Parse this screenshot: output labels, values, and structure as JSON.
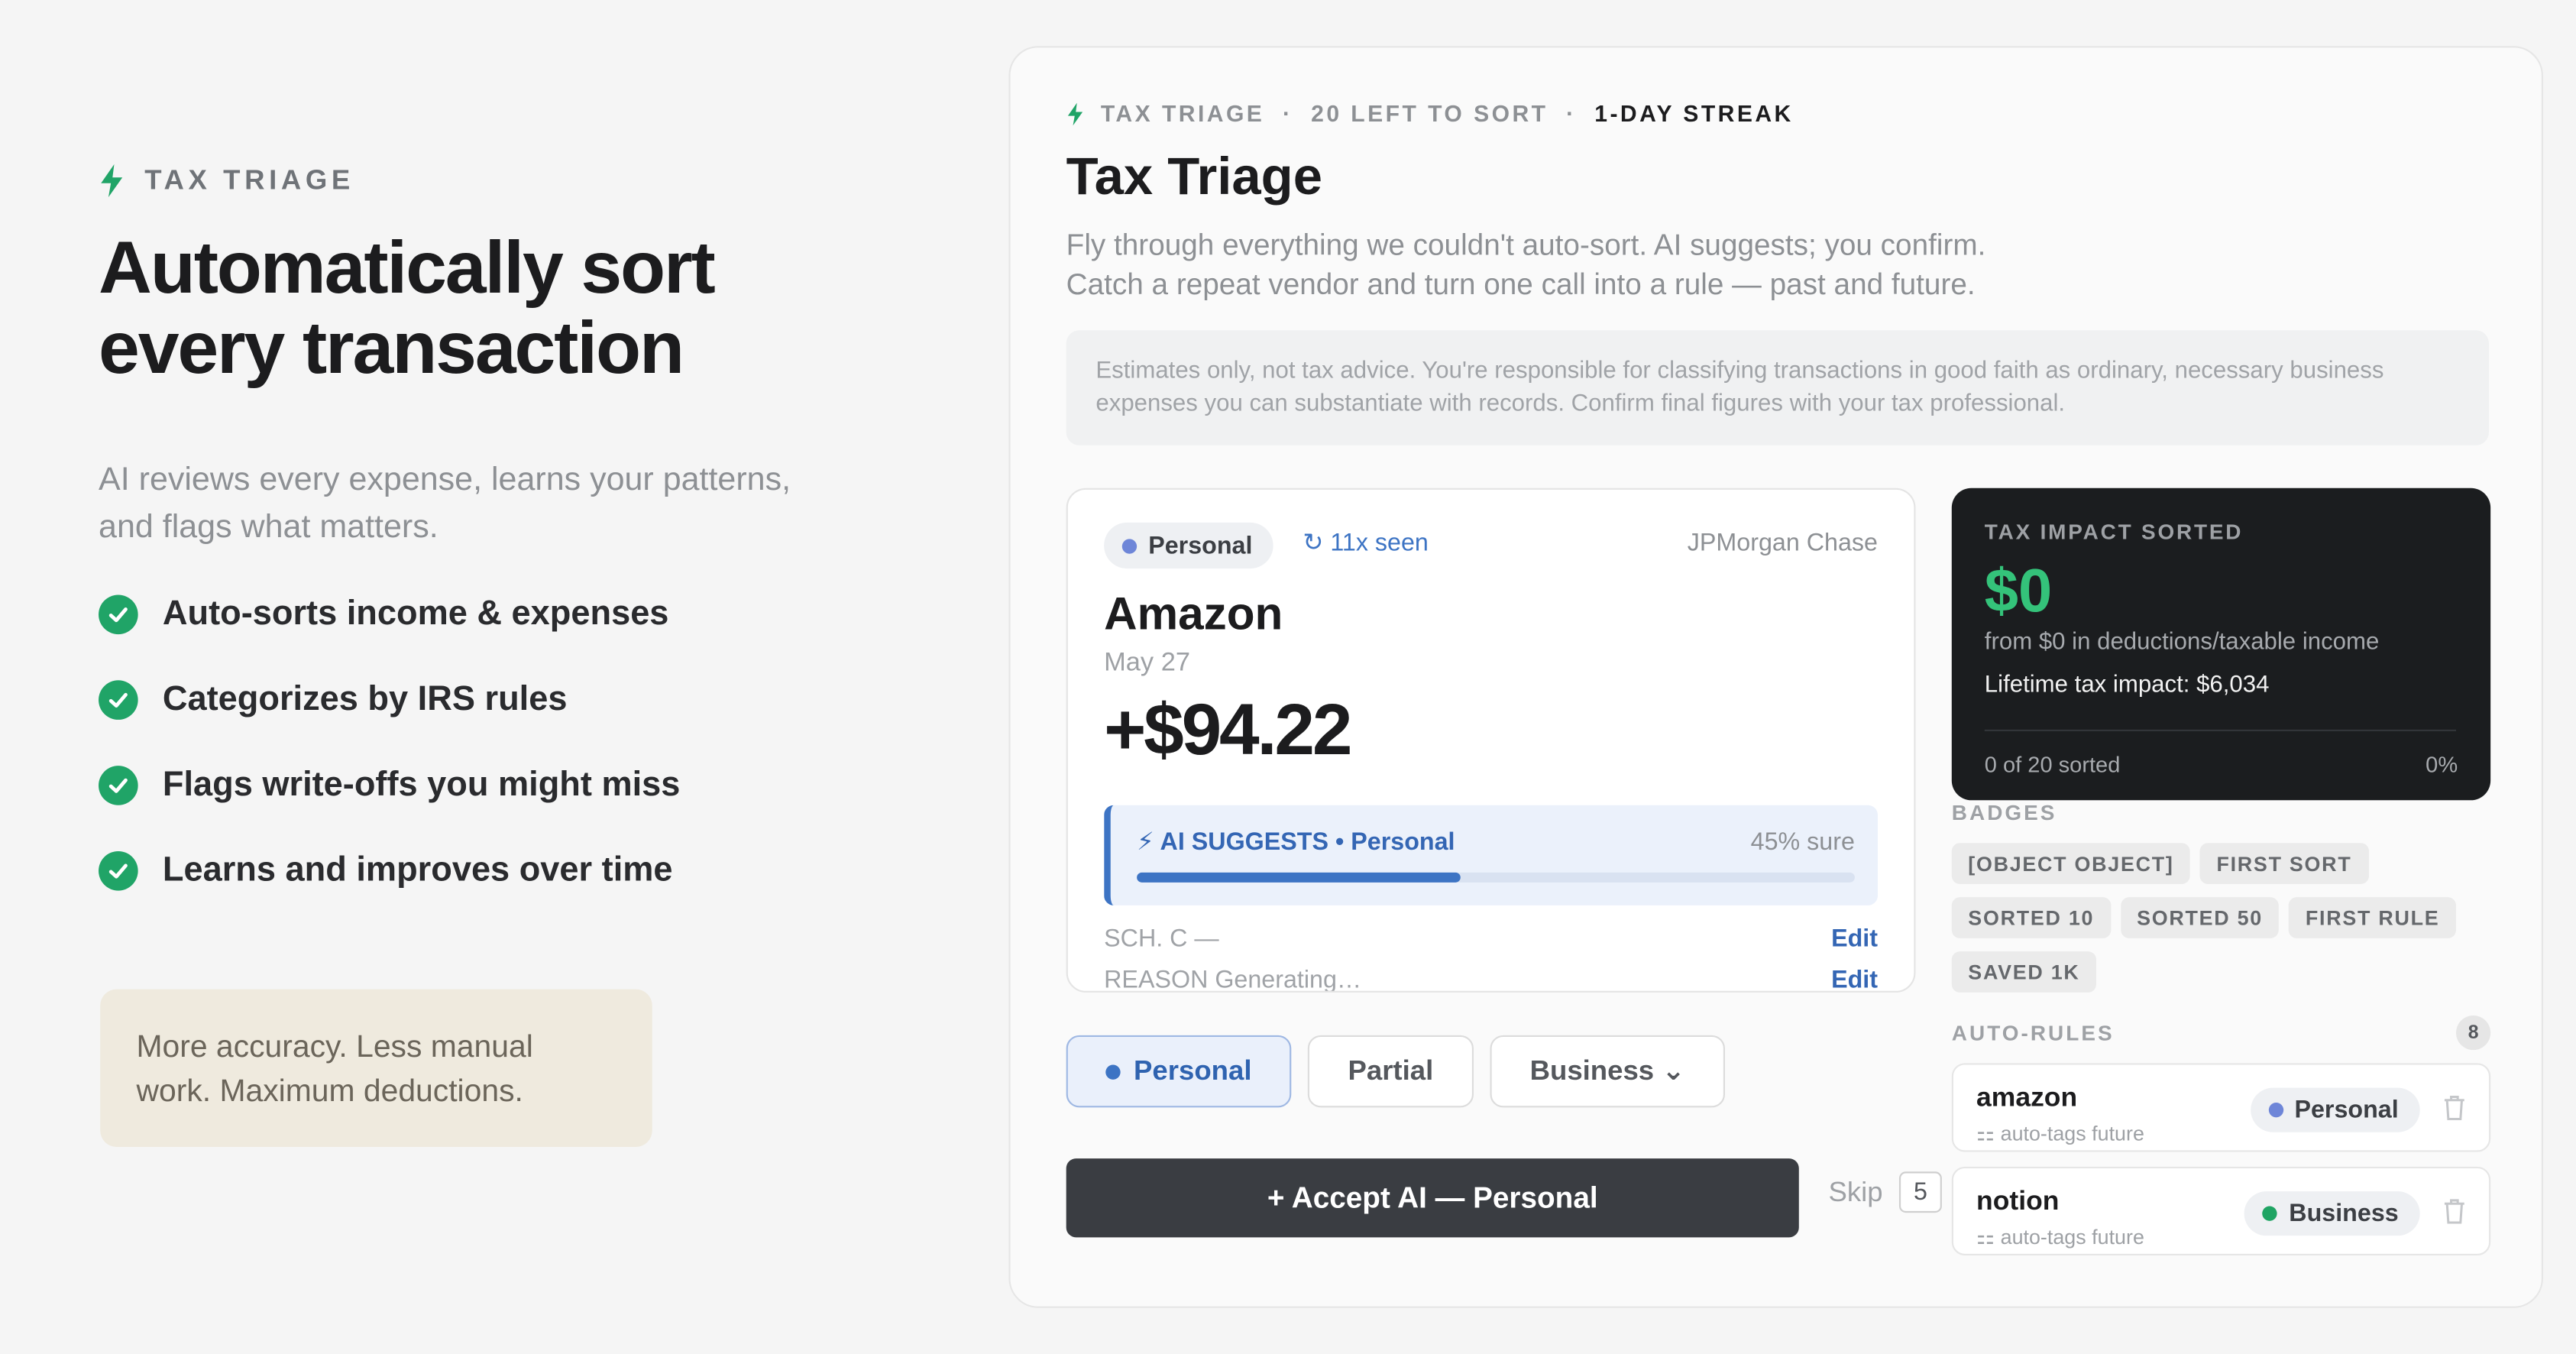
{
  "hero": {
    "eyebrow": "TAX TRIAGE",
    "title_line1": "Automatically sort",
    "title_line2": "every transaction",
    "subtitle": "AI reviews every expense, learns your patterns, and flags what matters.",
    "features": [
      "Auto-sorts income & expenses",
      "Categorizes by IRS rules",
      "Flags write-offs you might miss",
      "Learns and improves over time"
    ],
    "note": "More accuracy. Less manual work. Maximum deductions."
  },
  "panel": {
    "eyebrow": {
      "label": "TAX TRIAGE",
      "left": "20 LEFT TO SORT",
      "streak": "1-DAY STREAK",
      "separator": "·"
    },
    "title": "Tax Triage",
    "subtitle_line1": "Fly through everything we couldn't auto-sort. AI suggests; you confirm.",
    "subtitle_line2": "Catch a repeat vendor and turn one call into a rule — past and future.",
    "disclaimer": "Estimates only, not tax advice. You're responsible for classifying transactions in good faith as ordinary, necessary business expenses you can substantiate with records. Confirm final figures with your tax professional."
  },
  "transaction": {
    "tag": "Personal",
    "seen": "↻ 11x seen",
    "bank": "JPMorgan Chase",
    "merchant": "Amazon",
    "date": "May 27",
    "amount": "+$94.22",
    "ai": {
      "label": "⚡ AI SUGGESTS  •  Personal",
      "confidence_text": "45% sure",
      "confidence": 0.45
    },
    "sch_label": "SCH. C —",
    "reason_label": "REASON  Generating…",
    "edit_label": "Edit"
  },
  "choices": {
    "personal": "Personal",
    "partial": "Partial",
    "business": "Business ⌄"
  },
  "accept_label": "+ Accept AI — Personal",
  "skip": {
    "label": "Skip",
    "key": "5"
  },
  "impact": {
    "label": "TAX IMPACT SORTED",
    "value": "$0",
    "from": "from $0 in deductions/taxable income",
    "lifetime": "Lifetime tax impact: $6,034",
    "sorted": "0 of 20 sorted",
    "percent": "0%"
  },
  "badges": {
    "label": "BADGES",
    "items": [
      "[OBJECT OBJECT]",
      "FIRST SORT",
      "SORTED 10",
      "SORTED 50",
      "FIRST RULE",
      "SAVED 1K"
    ]
  },
  "auto_rules": {
    "label": "AUTO-RULES",
    "count": "8",
    "items": [
      {
        "name": "amazon",
        "sub": "⚏ auto-tags future",
        "category": "Personal"
      },
      {
        "name": "notion",
        "sub": "⚏ auto-tags future",
        "category": "Business"
      }
    ]
  },
  "colors": {
    "accent_green": "#20a467",
    "impact_green": "#34c37a",
    "personal_dot": "#6e86d8",
    "business_dot": "#1fa463",
    "link_blue": "#3d74c4"
  }
}
